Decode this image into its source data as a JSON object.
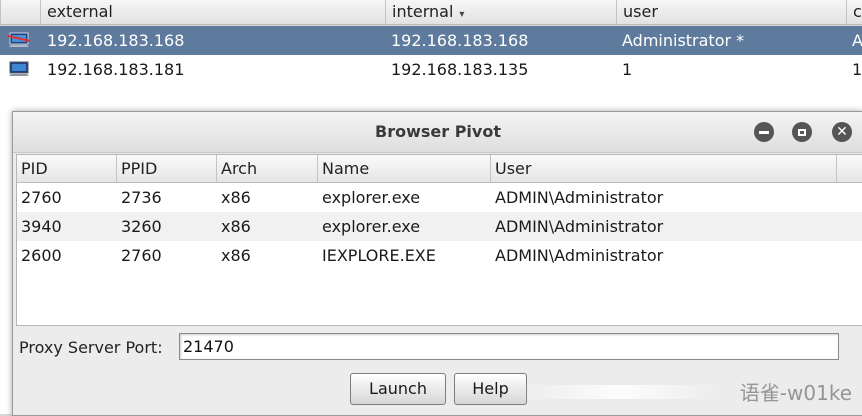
{
  "targets_table": {
    "columns": [
      {
        "label": "external"
      },
      {
        "label": "internal",
        "sort": "▾"
      },
      {
        "label": "user"
      },
      {
        "label": "c"
      }
    ],
    "rows": [
      {
        "external": "192.168.183.168",
        "internal": "192.168.183.168",
        "user": "Administrator *",
        "extra": "A",
        "selected": true
      },
      {
        "external": "192.168.183.181",
        "internal": "192.168.183.135",
        "user": "1",
        "extra": "1",
        "selected": false
      }
    ]
  },
  "dialog": {
    "title": "Browser Pivot",
    "controls": [
      "minimize-icon",
      "maximize-icon",
      "close-icon"
    ],
    "close_glyph": "✕",
    "columns": [
      "PID",
      "PPID",
      "Arch",
      "Name",
      "User"
    ],
    "processes": [
      {
        "pid": "2760",
        "ppid": "2736",
        "arch": "x86",
        "name": "explorer.exe",
        "user": "ADMIN\\Administrator"
      },
      {
        "pid": "3940",
        "ppid": "3260",
        "arch": "x86",
        "name": "explorer.exe",
        "user": "ADMIN\\Administrator"
      },
      {
        "pid": "2600",
        "ppid": "2760",
        "arch": "x86",
        "name": "IEXPLORE.EXE",
        "user": "ADMIN\\Administrator"
      }
    ],
    "port_label": "Proxy Server Port:",
    "port_value": "21470",
    "launch_label": "Launch",
    "help_label": "Help"
  },
  "watermark": "语雀-w01ke"
}
